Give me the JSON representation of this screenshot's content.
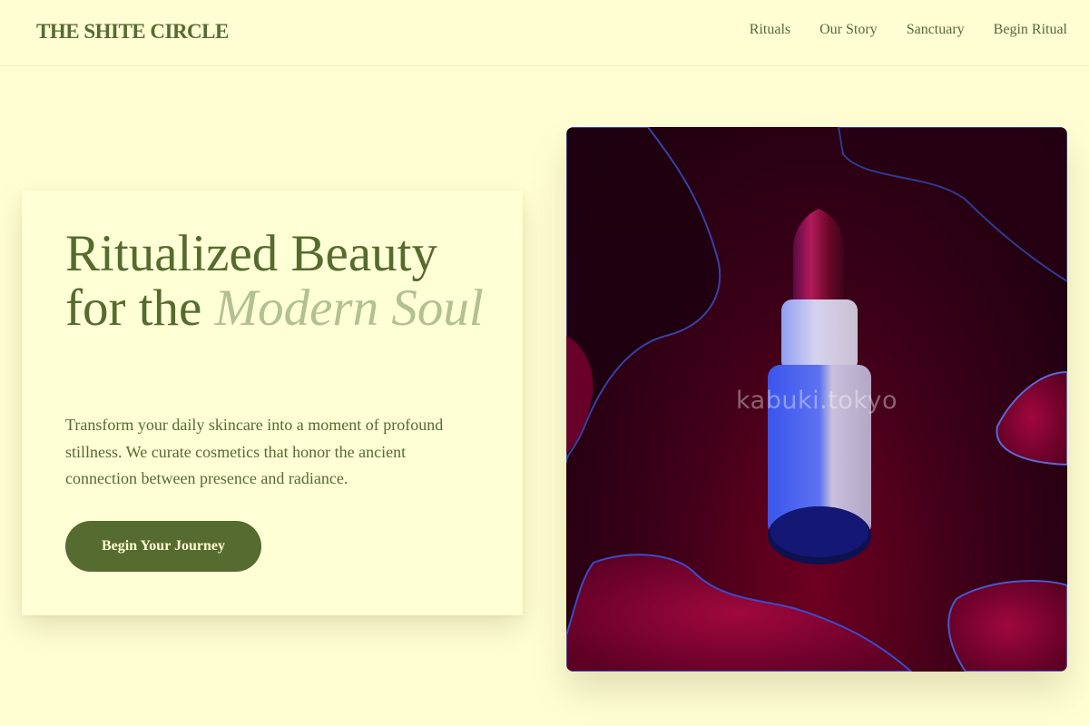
{
  "header": {
    "logo": "THE SHITE CIRCLE",
    "nav": [
      "Rituals",
      "Our Story",
      "Sanctuary",
      "Begin Ritual"
    ]
  },
  "hero": {
    "title_line1": "Ritualized Beauty",
    "title_line2": "for the",
    "title_accent": "Modern Soul",
    "description": "Transform your daily skincare into a moment of profound stillness. We curate cosmetics that honor the ancient connection between presence and radiance.",
    "cta_label": "Begin Your Journey"
  },
  "image": {
    "watermark": "kabuki.tokyo",
    "subject": "lipstick-on-red-liquid"
  },
  "colors": {
    "background": "#fffed3",
    "primary": "#556b2f",
    "accent": "#b3c08f",
    "button_text": "#fffed3"
  }
}
